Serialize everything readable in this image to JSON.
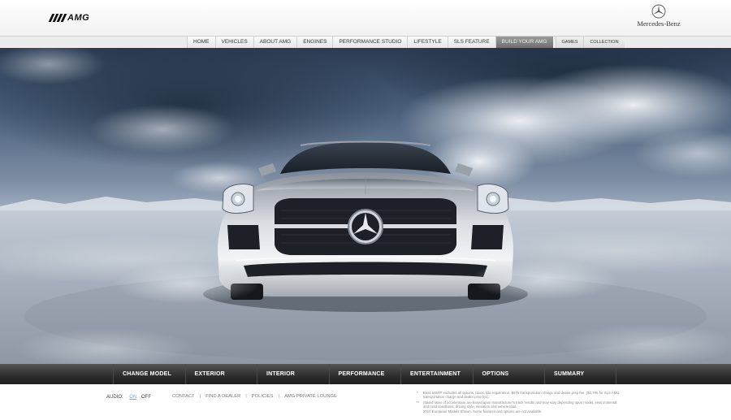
{
  "header": {
    "amg_logo_text": "AMG",
    "brand_text": "Mercedes-Benz"
  },
  "topnav": {
    "items": [
      {
        "label": "HOME"
      },
      {
        "label": "VEHICLES"
      },
      {
        "label": "ABOUT AMG"
      },
      {
        "label": "ENGINES"
      },
      {
        "label": "PERFORMANCE STUDIO"
      },
      {
        "label": "LIFESTYLE"
      },
      {
        "label": "SLS FEATURE"
      },
      {
        "label": "BUILD YOUR AMG",
        "active": true
      },
      {
        "label": "GAMES"
      },
      {
        "label": "COLLECTION"
      }
    ]
  },
  "hero": {
    "image": "silver Mercedes-Benz SLS AMG front view on snowy landscape under cloudy sky"
  },
  "configurator": {
    "tabs": [
      {
        "label": "CHANGE MODEL"
      },
      {
        "label": "EXTERIOR"
      },
      {
        "label": "INTERIOR"
      },
      {
        "label": "PERFORMANCE"
      },
      {
        "label": "ENTERTAINMENT"
      },
      {
        "label": "OPTIONS"
      },
      {
        "label": "SUMMARY"
      }
    ]
  },
  "footer": {
    "audio_label": "AUDIO:",
    "audio_on": "ON",
    "audio_off": "OFF",
    "links": [
      {
        "label": "CONTACT"
      },
      {
        "label": "FIND A DEALER"
      },
      {
        "label": "POLICIES"
      },
      {
        "label": "AMG PRIVATE LOUNGE"
      }
    ],
    "disclaimers": [
      {
        "marker": "*",
        "text": "Base MSRP excludes all options, taxes, title registration, $875 transportation charge and dealer prep fee. ($2,795 for SLS AMG transportation charge and dealer prep fee)."
      },
      {
        "marker": "**",
        "text": "Stated rates of acceleration are based upon manufacturer's track results and may vary depending upon model, environmental and road conditions, driving style, elevation and vehicle load."
      },
      {
        "marker": "",
        "text": "2010 European Models Shown. Some features and options are not available."
      }
    ]
  },
  "colors": {
    "active_nav": "#7a7a7a",
    "bottom_bar": "#2c2c2c",
    "audio_on": "#8aa6c8"
  }
}
